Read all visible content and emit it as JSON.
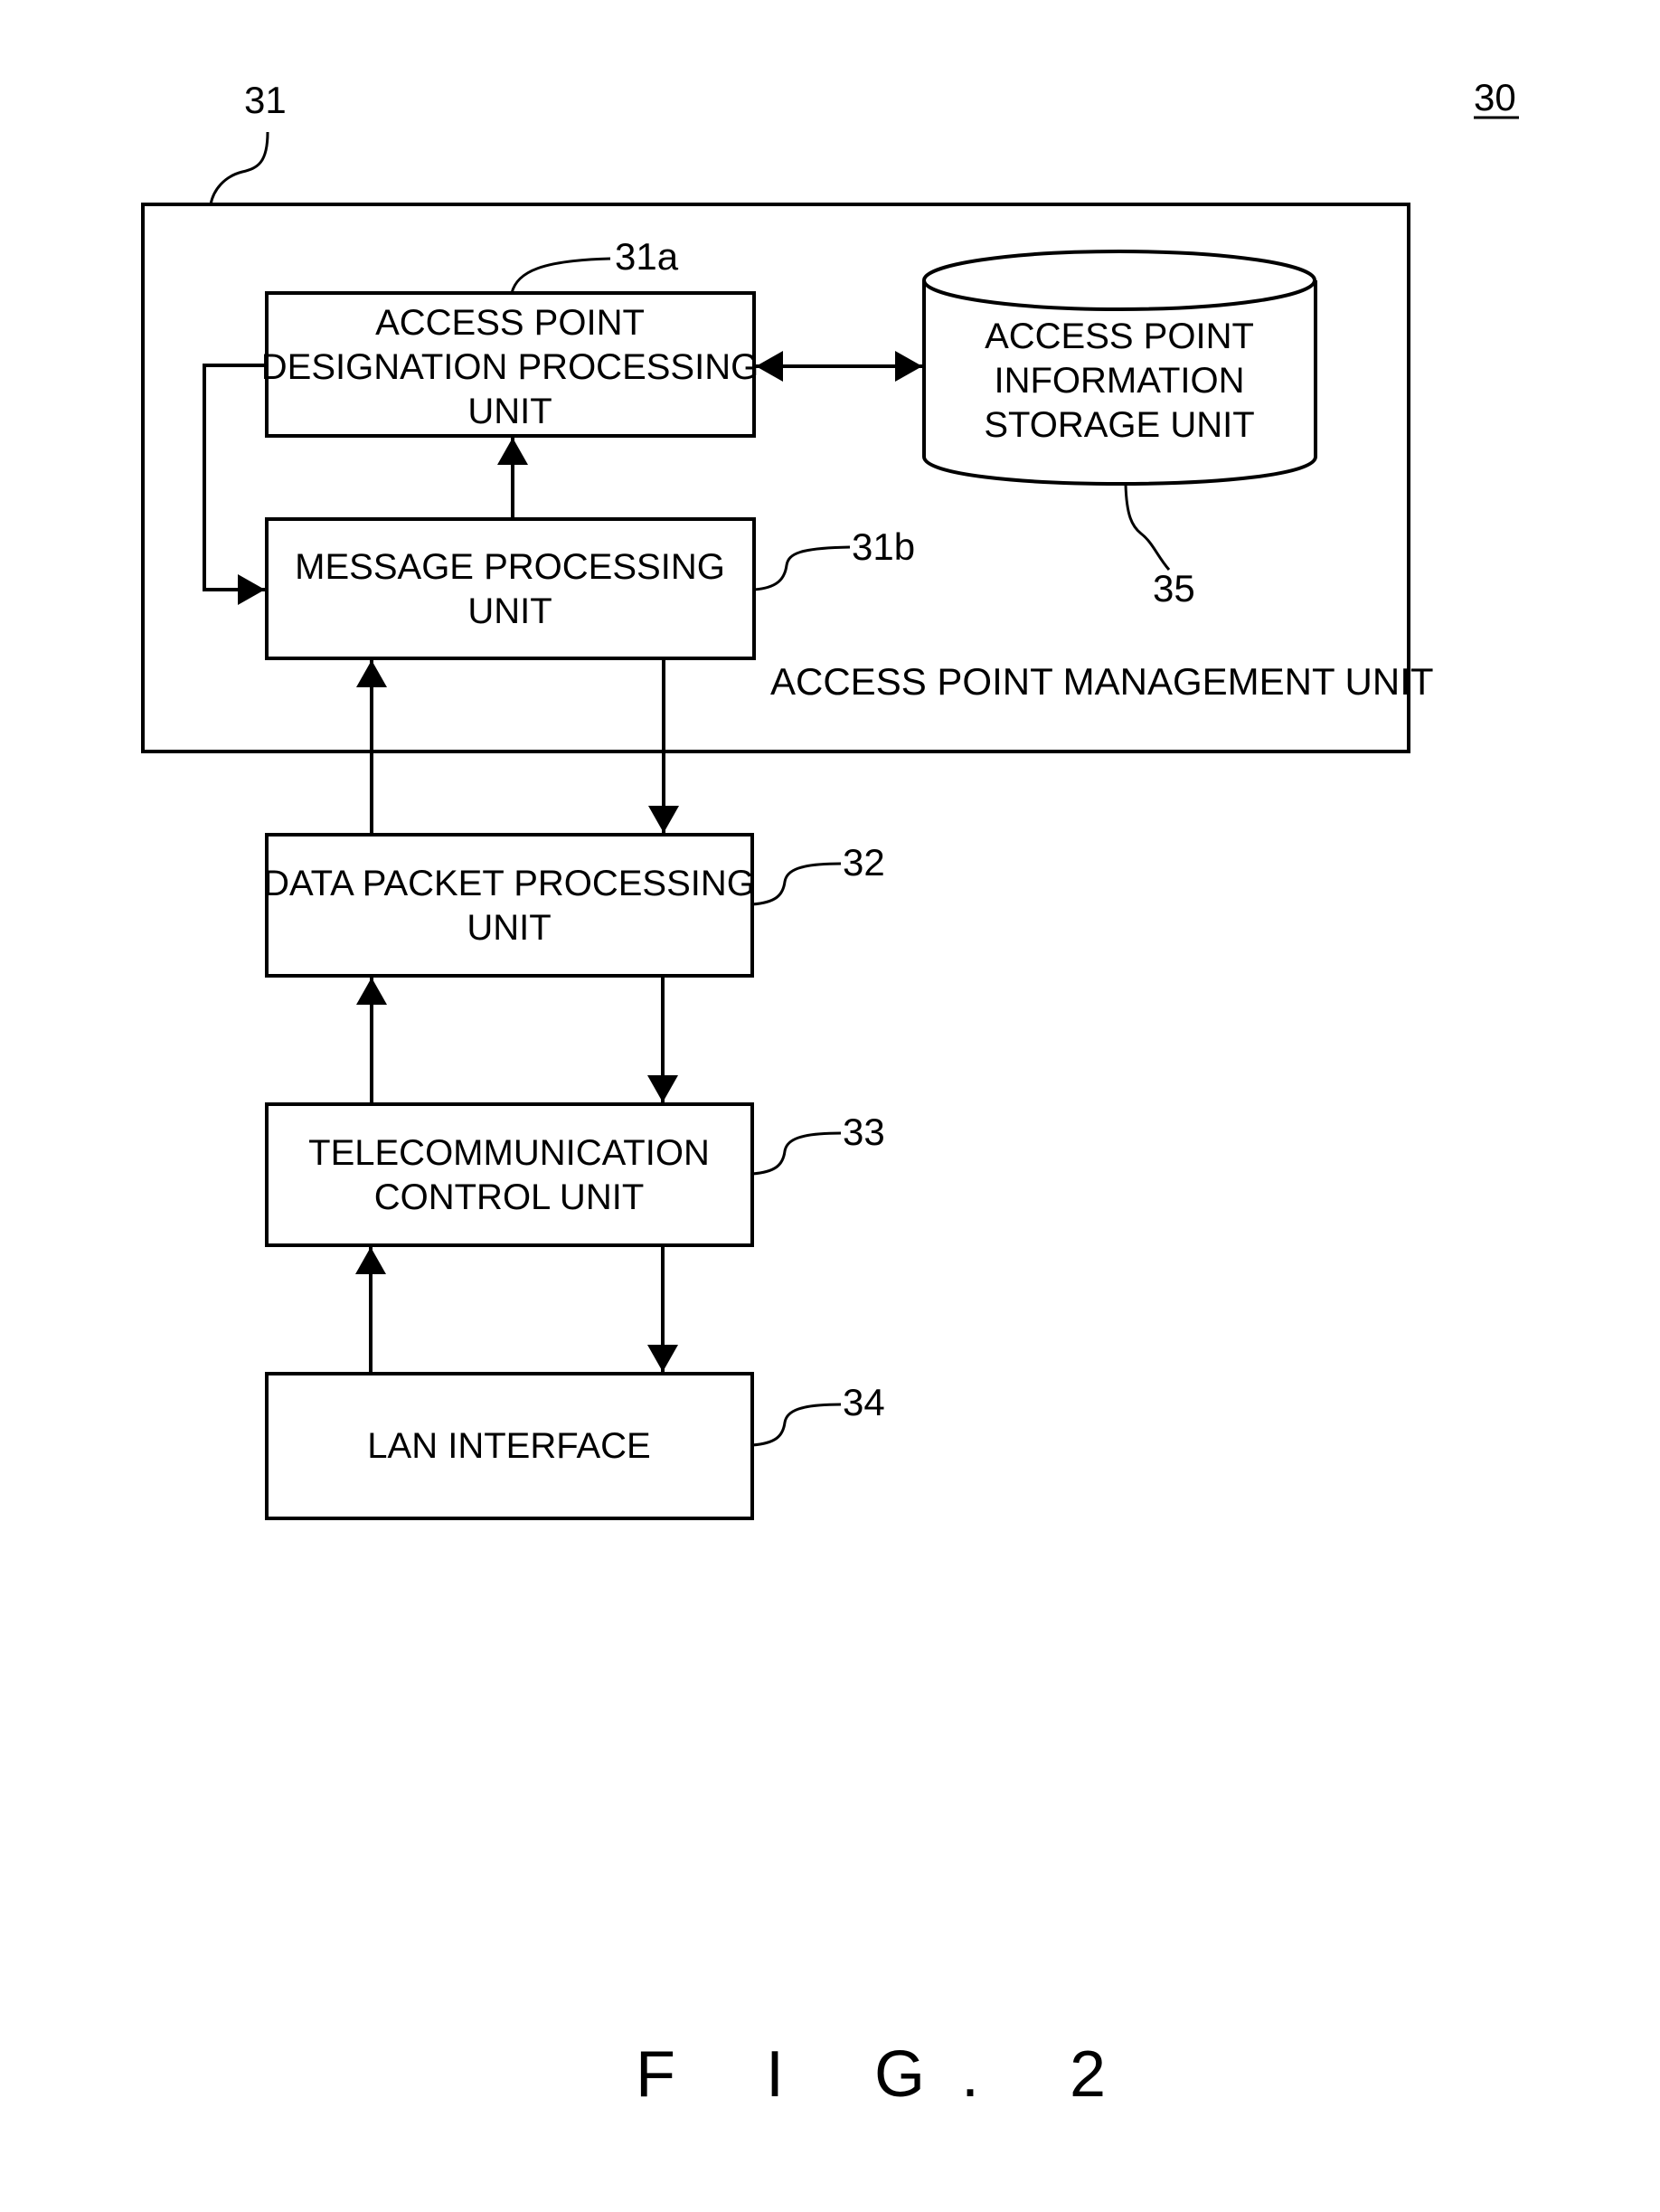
{
  "figure": {
    "caption": "F I G. 2",
    "ref_main": "30"
  },
  "management_unit": {
    "ref": "31",
    "label": "ACCESS POINT MANAGEMENT UNIT"
  },
  "blocks": {
    "designation": {
      "ref": "31a",
      "lines": [
        "ACCESS POINT",
        "DESIGNATION PROCESSING",
        "UNIT"
      ]
    },
    "message": {
      "ref": "31b",
      "lines": [
        "MESSAGE PROCESSING",
        "UNIT"
      ]
    },
    "storage": {
      "ref": "35",
      "lines": [
        "ACCESS POINT",
        "INFORMATION",
        "STORAGE UNIT"
      ]
    },
    "data_packet": {
      "ref": "32",
      "lines": [
        "DATA PACKET PROCESSING",
        "UNIT"
      ]
    },
    "telecom": {
      "ref": "33",
      "lines": [
        "TELECOMMUNICATION",
        "CONTROL UNIT"
      ]
    },
    "lan": {
      "ref": "34",
      "lines": [
        "LAN INTERFACE"
      ]
    }
  },
  "connections": [
    {
      "from": "designation",
      "to": "storage",
      "direction": "bidirectional"
    },
    {
      "from": "message",
      "to": "designation",
      "direction": "forward"
    },
    {
      "from": "designation",
      "to": "message",
      "direction": "forward",
      "route": "left-loop"
    },
    {
      "from": "data_packet",
      "to": "message",
      "direction": "forward"
    },
    {
      "from": "message",
      "to": "data_packet",
      "direction": "forward"
    },
    {
      "from": "telecom",
      "to": "data_packet",
      "direction": "forward"
    },
    {
      "from": "data_packet",
      "to": "telecom",
      "direction": "forward"
    },
    {
      "from": "lan",
      "to": "telecom",
      "direction": "forward"
    },
    {
      "from": "telecom",
      "to": "lan",
      "direction": "forward"
    }
  ]
}
